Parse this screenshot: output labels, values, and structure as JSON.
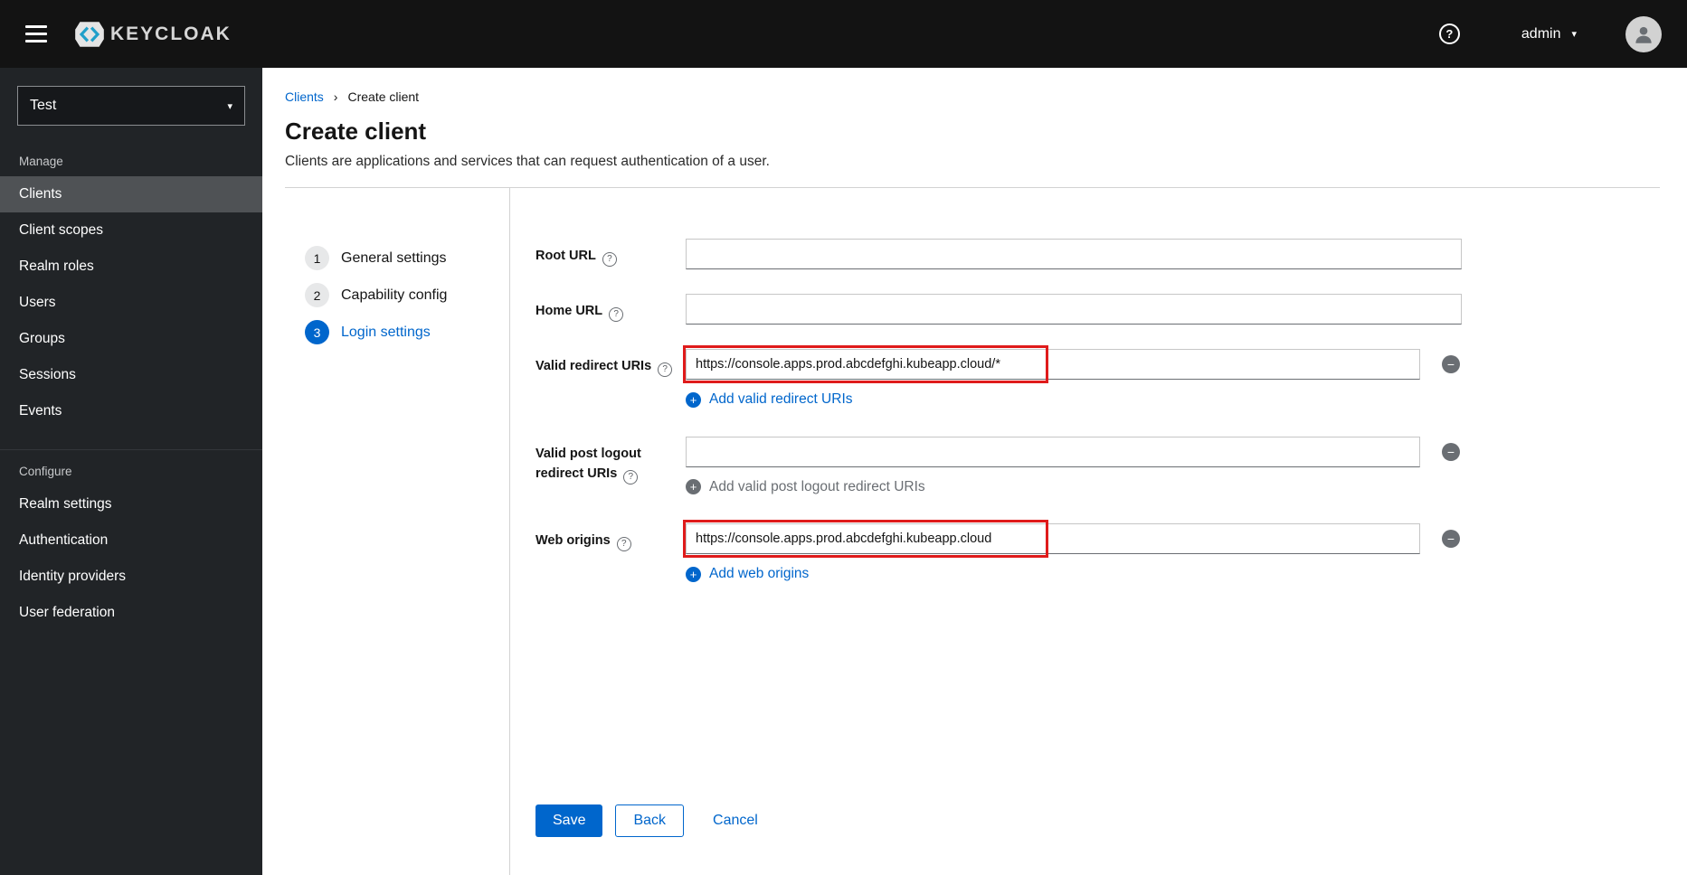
{
  "colors": {
    "accent": "#0066cc",
    "annotation_highlight": "#df1b1b",
    "topbar": "#131313",
    "sidebar": "#212427",
    "selected_nav": "#4f5255"
  },
  "icons": {
    "help": "?",
    "caret": "▾",
    "breadcrumb_separator": "›",
    "plus": "+",
    "minus": "−"
  },
  "header": {
    "brand": "KEYCLOAK",
    "username": "admin"
  },
  "sidebar": {
    "realm": "Test",
    "groups": [
      {
        "label": "Manage",
        "items": [
          {
            "label": "Clients",
            "selected": true
          },
          {
            "label": "Client scopes"
          },
          {
            "label": "Realm roles"
          },
          {
            "label": "Users"
          },
          {
            "label": "Groups"
          },
          {
            "label": "Sessions"
          },
          {
            "label": "Events"
          }
        ]
      },
      {
        "label": "Configure",
        "items": [
          {
            "label": "Realm settings"
          },
          {
            "label": "Authentication"
          },
          {
            "label": "Identity providers"
          },
          {
            "label": "User federation"
          }
        ]
      }
    ]
  },
  "breadcrumb": {
    "parent": "Clients",
    "current": "Create client"
  },
  "page": {
    "title": "Create client",
    "subtitle": "Clients are applications and services that can request authentication of a user."
  },
  "wizard": {
    "steps": [
      {
        "num": "1",
        "label": "General settings"
      },
      {
        "num": "2",
        "label": "Capability config"
      },
      {
        "num": "3",
        "label": "Login settings",
        "active": true
      }
    ]
  },
  "form": {
    "root_url": {
      "label": "Root URL",
      "value": ""
    },
    "home_url": {
      "label": "Home URL",
      "value": ""
    },
    "valid_redirect_uris": {
      "label": "Valid redirect URIs",
      "value": "https://console.apps.prod.abcdefghi.kubeapp.cloud/*",
      "add_label": "Add valid redirect URIs"
    },
    "post_logout_uris": {
      "label": "Valid post logout redirect URIs",
      "value": "",
      "add_label": "Add valid post logout redirect URIs"
    },
    "web_origins": {
      "label": "Web origins",
      "value": "https://console.apps.prod.abcdefghi.kubeapp.cloud",
      "add_label": "Add web origins"
    }
  },
  "actions": {
    "save": "Save",
    "back": "Back",
    "cancel": "Cancel"
  }
}
